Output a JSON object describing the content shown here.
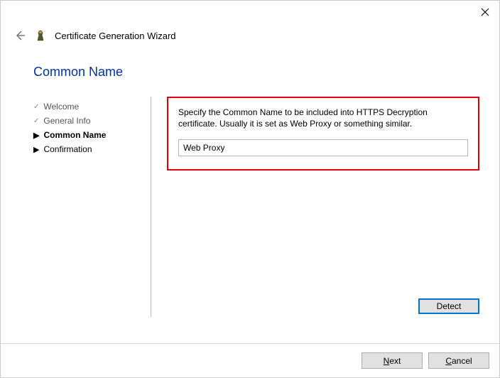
{
  "window": {
    "wizard_title": "Certificate Generation Wizard"
  },
  "page": {
    "heading": "Common Name"
  },
  "steps": {
    "welcome": "Welcome",
    "general_info": "General Info",
    "common_name": "Common Name",
    "confirmation": "Confirmation"
  },
  "main": {
    "instruction": "Specify the Common Name to be included into HTTPS Decryption certificate. Usually it is set as Web Proxy or something similar.",
    "common_name_value": "Web Proxy",
    "detect_label": "Detect"
  },
  "footer": {
    "next_label": "Next",
    "cancel_label": "Cancel"
  }
}
